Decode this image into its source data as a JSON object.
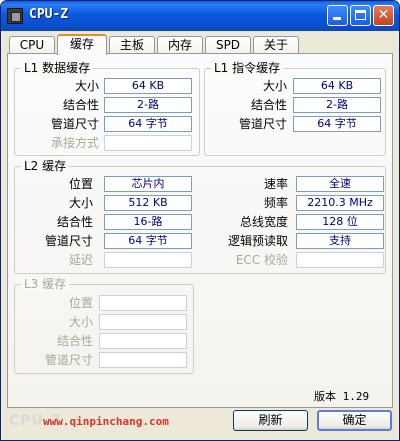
{
  "window": {
    "title": "CPU-Z"
  },
  "tabs": [
    "CPU",
    "缓存",
    "主板",
    "内存",
    "SPD",
    "关于"
  ],
  "active_tab": "缓存",
  "l1_data": {
    "title": "L1 数据缓存",
    "rows": [
      {
        "label": "大小",
        "value": "64 KB"
      },
      {
        "label": "结合性",
        "value": "2-路"
      },
      {
        "label": "管道尺寸",
        "value": "64 字节"
      },
      {
        "label": "承接方式",
        "value": ""
      }
    ]
  },
  "l1_inst": {
    "title": "L1 指令缓存",
    "rows": [
      {
        "label": "大小",
        "value": "64 KB"
      },
      {
        "label": "结合性",
        "value": "2-路"
      },
      {
        "label": "管道尺寸",
        "value": "64 字节"
      }
    ]
  },
  "l2": {
    "title": "L2 缓存",
    "left": [
      {
        "label": "位置",
        "value": "芯片内"
      },
      {
        "label": "大小",
        "value": "512 KB"
      },
      {
        "label": "结合性",
        "value": "16-路"
      },
      {
        "label": "管道尺寸",
        "value": "64 字节"
      },
      {
        "label": "延迟",
        "value": ""
      }
    ],
    "right": [
      {
        "label": "速率",
        "value": "全速"
      },
      {
        "label": "频率",
        "value": "2210.3 MHz"
      },
      {
        "label": "总线宽度",
        "value": "128 位"
      },
      {
        "label": "逻辑预读取",
        "value": "支持"
      },
      {
        "label": "ECC 校验",
        "value": ""
      }
    ]
  },
  "l3": {
    "title": "L3 缓存",
    "rows": [
      {
        "label": "位置",
        "value": ""
      },
      {
        "label": "大小",
        "value": ""
      },
      {
        "label": "结合性",
        "value": ""
      },
      {
        "label": "管道尺寸",
        "value": ""
      }
    ]
  },
  "footer": {
    "version": "版本 1.29",
    "watermark": "CPU-Z",
    "url": "www.qinpinchang.com",
    "refresh_label": "刷新",
    "ok_label": "确定"
  }
}
